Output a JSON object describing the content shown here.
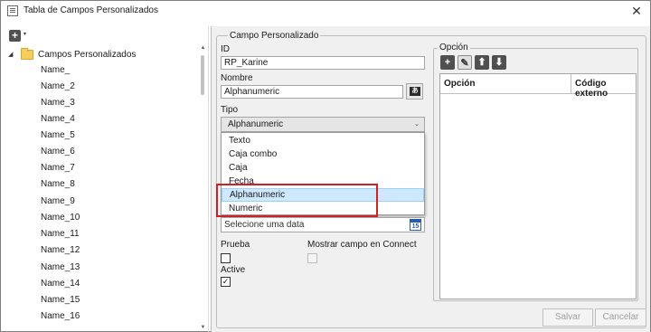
{
  "window": {
    "title": "Tabla de Campos Personalizados",
    "close_glyph": "✕"
  },
  "toolbar": {
    "add_icon": "+",
    "add_caret": "▾"
  },
  "tree": {
    "root_label": "Campos Personalizados",
    "items": [
      "Name_",
      "Name_2",
      "Name_3",
      "Name_4",
      "Name_5",
      "Name_6",
      "Name_7",
      "Name_8",
      "Name_9",
      "Name_10",
      "Name_11",
      "Name_12",
      "Name_13",
      "Name_14",
      "Name_15",
      "Name_16"
    ]
  },
  "form": {
    "group_title": "Campo Personalizado",
    "id_label": "ID",
    "id_value": "RP_Karine",
    "name_label": "Nombre",
    "name_value": "Alphanumeric",
    "type_label": "Tipo",
    "type_value": "Alphanumeric",
    "type_options": [
      "Texto",
      "Caja combo",
      "Caja",
      "Fecha",
      "Alphanumeric",
      "Numeric"
    ],
    "type_selected_index": 4,
    "date_placeholder": "Selecione uma data",
    "calendar_day": "15",
    "test_label": "Prueba",
    "test_checked": false,
    "show_connect_label": "Mostrar campo en Connect",
    "show_connect_checked": false,
    "active_label": "Active",
    "active_checked": true,
    "check_glyph": "✓"
  },
  "options": {
    "title": "Opción",
    "col_option": "Opción",
    "col_external_code": "Código externo"
  },
  "buttons": {
    "save": "Salvar",
    "cancel": "Cancelar"
  },
  "colors": {
    "highlight": "#d11f2a",
    "selected_bg": "#cde8ff",
    "pane_bg": "#f0f0f0"
  }
}
